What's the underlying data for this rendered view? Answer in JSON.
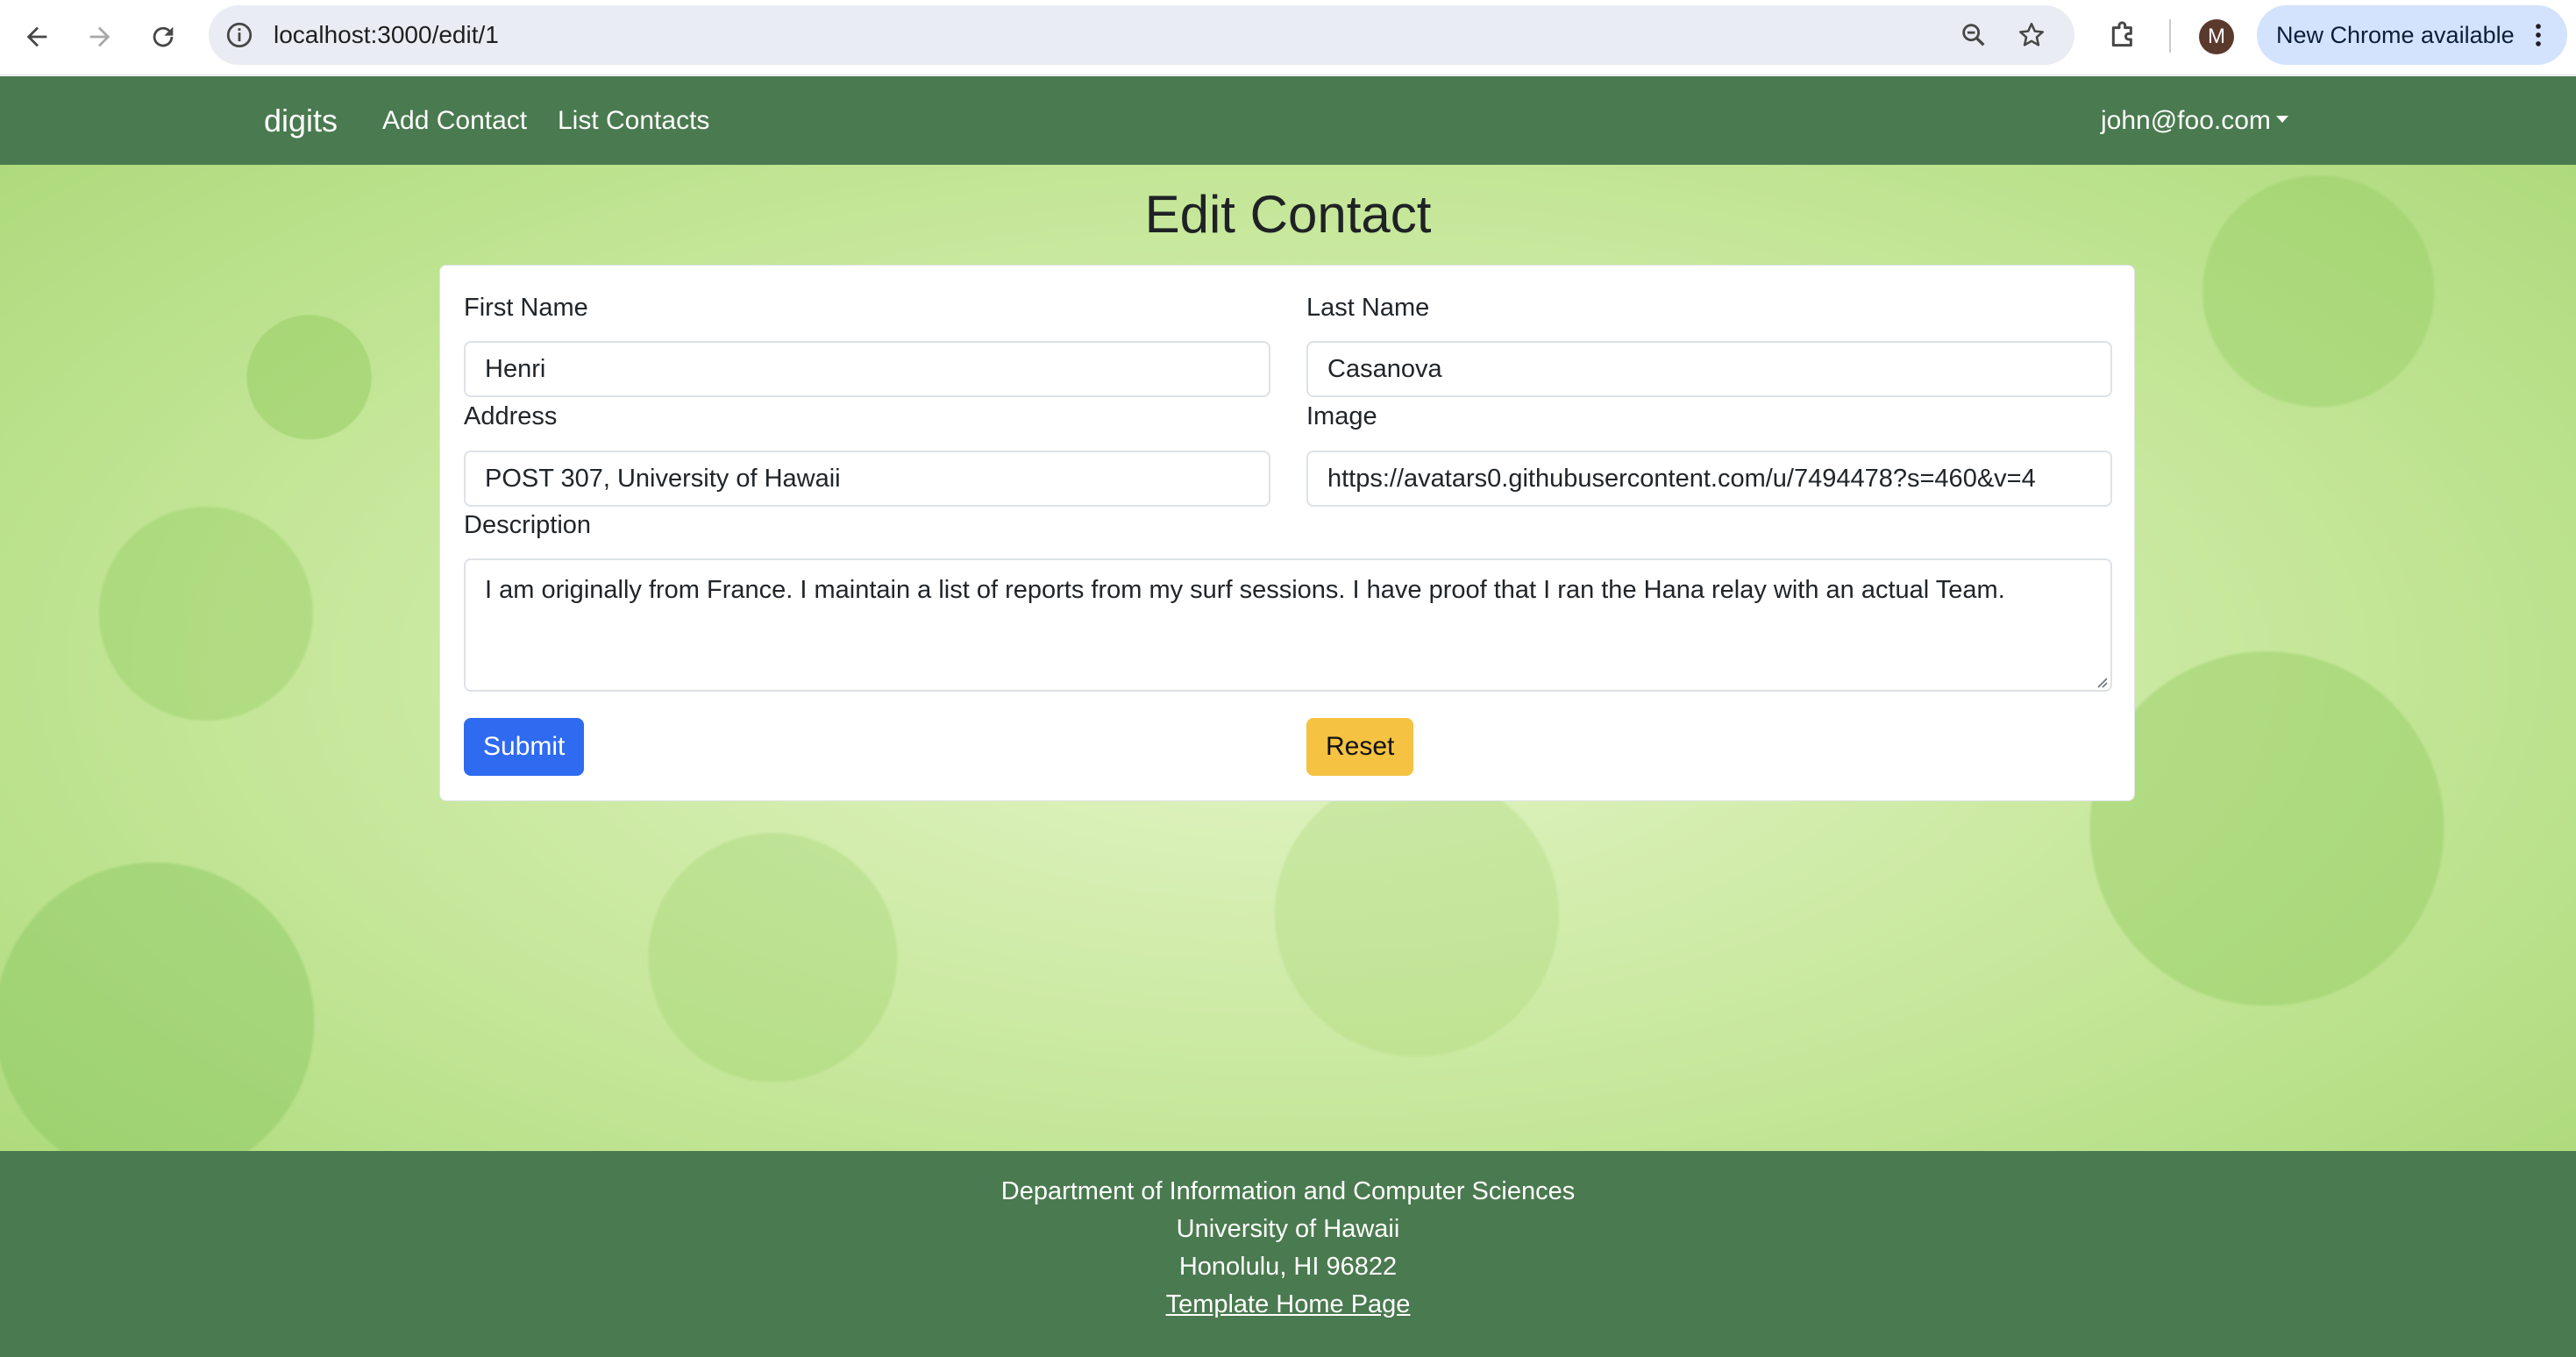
{
  "browser": {
    "url": "localhost:3000/edit/1",
    "avatar_letter": "M",
    "update_label": "New Chrome available"
  },
  "navbar": {
    "brand": "digits",
    "links": [
      "Add Contact",
      "List Contacts"
    ],
    "user": "john@foo.com"
  },
  "page": {
    "title": "Edit Contact"
  },
  "form": {
    "first_name": {
      "label": "First Name",
      "value": "Henri"
    },
    "last_name": {
      "label": "Last Name",
      "value": "Casanova"
    },
    "address": {
      "label": "Address",
      "value": "POST 307, University of Hawaii"
    },
    "image": {
      "label": "Image",
      "value": "https://avatars0.githubusercontent.com/u/7494478?s=460&v=4"
    },
    "description": {
      "label": "Description",
      "value": "I am originally from France. I maintain a list of reports from my surf sessions. I have proof that I ran the Hana relay with an actual Team."
    },
    "submit_label": "Submit",
    "reset_label": "Reset"
  },
  "footer": {
    "lines": [
      "Department of Information and Computer Sciences",
      "University of Hawaii",
      "Honolulu, HI 96822"
    ],
    "link": "Template Home Page"
  },
  "colors": {
    "navbar_bg": "#4a7a4f",
    "submit_bg": "#2f6bf0",
    "reset_bg": "#f5c242"
  }
}
